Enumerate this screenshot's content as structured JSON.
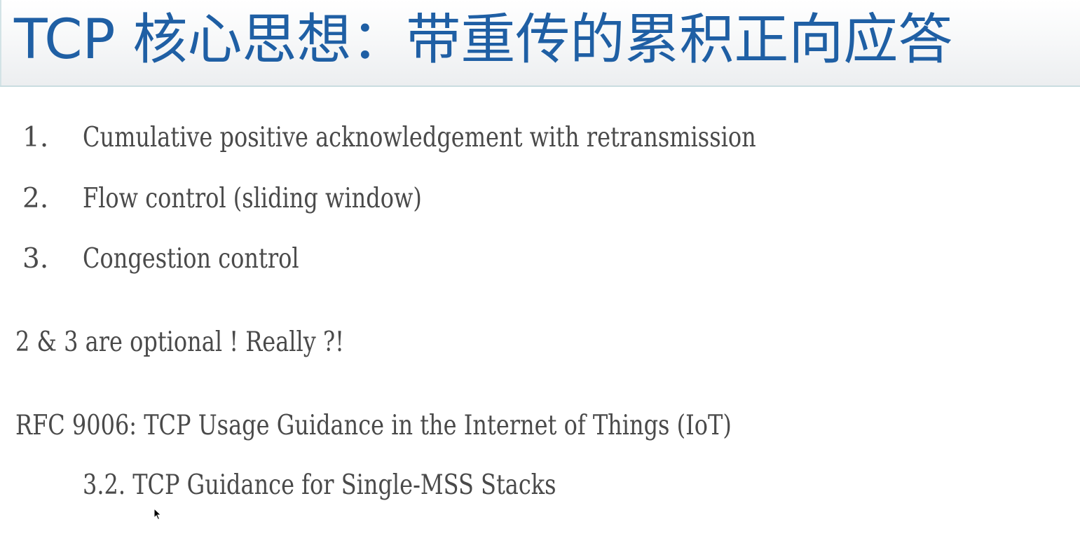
{
  "slide": {
    "title": "TCP 核心思想：带重传的累积正向应答",
    "list": [
      {
        "number": "1.",
        "label": "Cumulative positive acknowledgement with retransmission"
      },
      {
        "number": "2.",
        "label": "Flow control (sliding window)"
      },
      {
        "number": "3.",
        "label": "Congestion control"
      }
    ],
    "note": "2 & 3 are optional ! Really ?!",
    "rfc_line": "RFC 9006: TCP Usage Guidance in the Internet of Things (IoT)",
    "rfc_section": "3.2. TCP Guidance for Single-MSS Stacks"
  },
  "colors": {
    "title": "#1f5fa4",
    "body_text": "#4a4a4a",
    "title_band_border": "#c9dde0"
  },
  "icons": {
    "cursor": "mouse-pointer-icon"
  }
}
